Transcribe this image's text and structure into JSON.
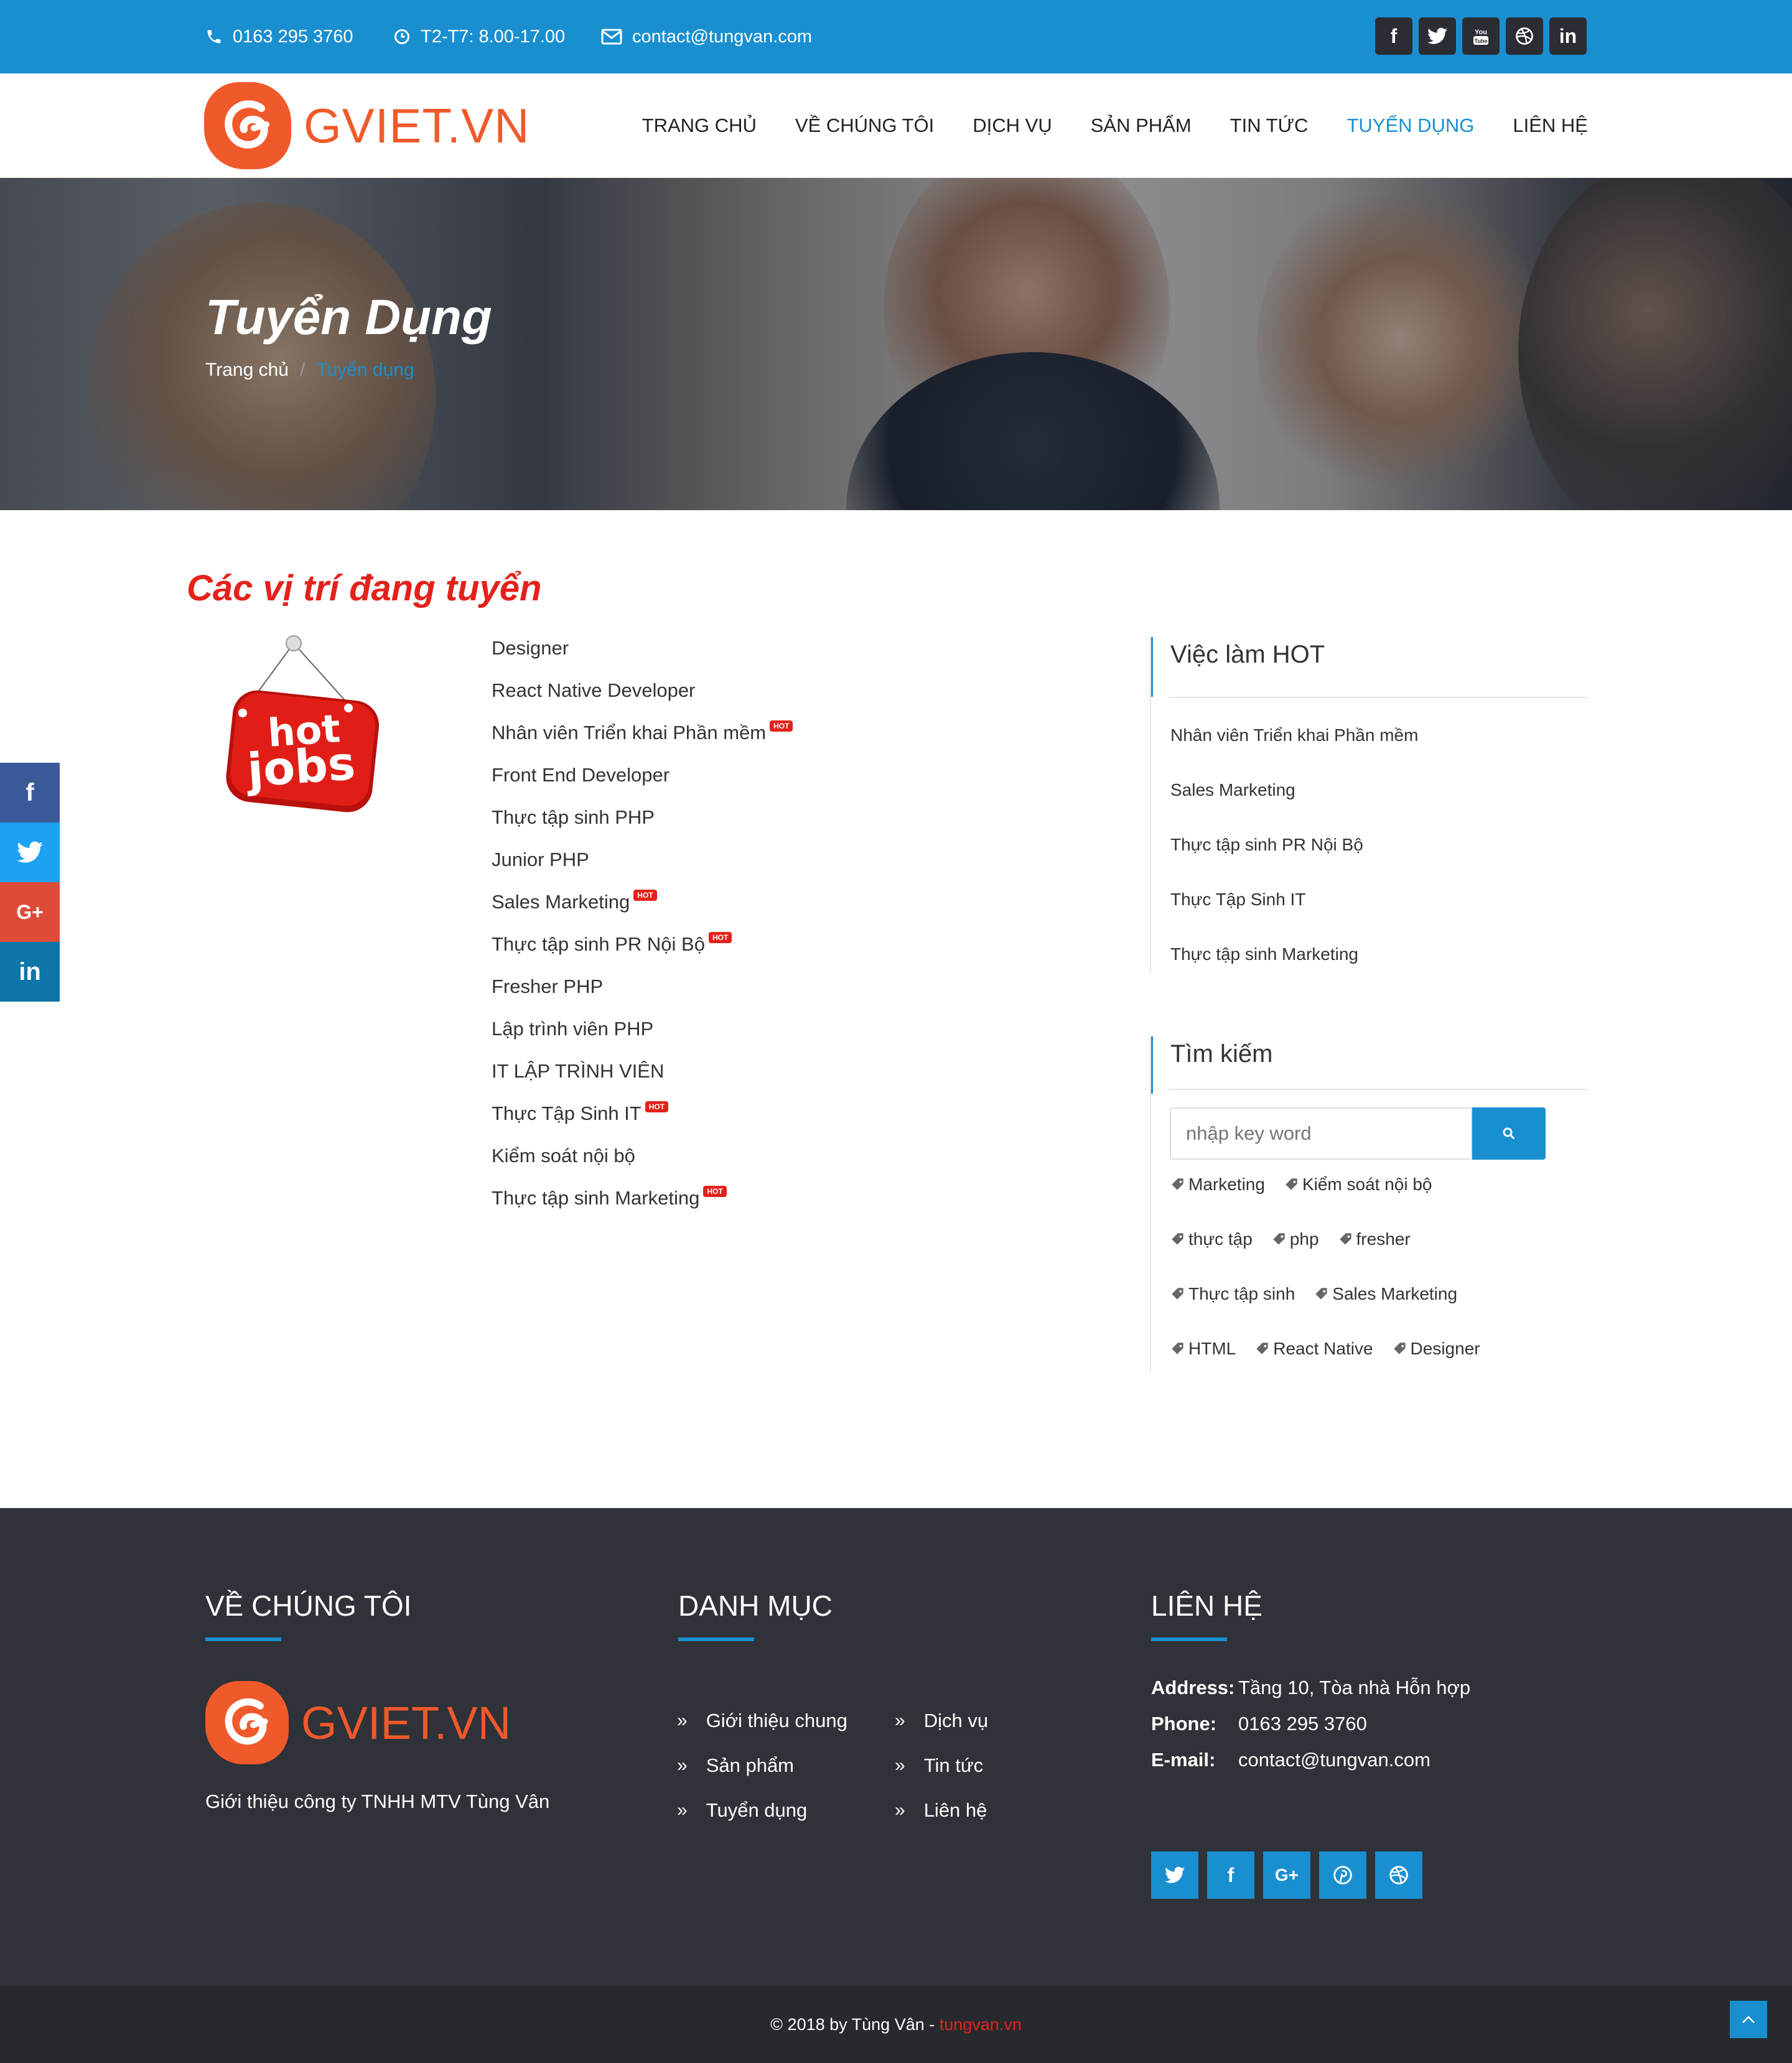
{
  "topbar": {
    "phone": "0163 295 3760",
    "hours": "T2-T7: 8.00-17.00",
    "email": "contact@tungvan.com",
    "social": [
      "facebook",
      "twitter",
      "youtube",
      "dribbble",
      "linkedin"
    ]
  },
  "header": {
    "logo_text": "GVIET.VN",
    "nav": [
      {
        "label": "TRANG CHỦ"
      },
      {
        "label": "VỀ CHÚNG TÔI"
      },
      {
        "label": "DỊCH VỤ"
      },
      {
        "label": "SẢN PHẨM"
      },
      {
        "label": "TIN TỨC"
      },
      {
        "label": "TUYỂN DỤNG",
        "active": true
      },
      {
        "label": "LIÊN HỆ"
      }
    ]
  },
  "banner": {
    "title": "Tuyển Dụng",
    "breadcrumb_home": "Trang chủ",
    "breadcrumb_sep": "/",
    "breadcrumb_current": "Tuyển dụng"
  },
  "main": {
    "section_title": "Các vị trí đang tuyển",
    "image_alt": "hot jobs",
    "hot_label": "HOT",
    "jobs": [
      {
        "title": "Designer",
        "hot": false
      },
      {
        "title": "React Native Developer",
        "hot": false
      },
      {
        "title": "Nhân viên Triển khai Phần mềm",
        "hot": true
      },
      {
        "title": "Front End Developer",
        "hot": false
      },
      {
        "title": "Thực tập sinh PHP",
        "hot": false
      },
      {
        "title": "Junior PHP",
        "hot": false
      },
      {
        "title": "Sales Marketing",
        "hot": true
      },
      {
        "title": "Thực tập sinh PR Nội Bộ",
        "hot": true
      },
      {
        "title": "Fresher PHP",
        "hot": false
      },
      {
        "title": "Lập trình viên PHP",
        "hot": false
      },
      {
        "title": "IT LẬP TRÌNH VIÊN",
        "hot": false
      },
      {
        "title": "Thực Tập Sinh IT",
        "hot": true
      },
      {
        "title": "Kiểm soát nội bộ",
        "hot": false
      },
      {
        "title": "Thực tập sinh Marketing",
        "hot": true
      }
    ]
  },
  "sidebar": {
    "hot_title": "Việc làm HOT",
    "hot_items": [
      "Nhân viên Triển khai Phần mềm",
      "Sales Marketing",
      "Thực tập sinh PR Nội Bộ",
      "Thực Tập Sinh IT",
      "Thực tập sinh Marketing"
    ],
    "search_title": "Tìm kiếm",
    "search_placeholder": "nhập key word",
    "tag_rows": [
      [
        "Marketing",
        "Kiểm soát nội bộ"
      ],
      [
        "thực tập",
        "php",
        "fresher"
      ],
      [
        "Thực tập sinh",
        "Sales Marketing"
      ],
      [
        "HTML",
        "React Native",
        "Designer"
      ]
    ]
  },
  "sticky_social": [
    "facebook",
    "twitter",
    "google-plus",
    "linkedin"
  ],
  "footer": {
    "about_title": "VỀ CHÚNG TÔI",
    "about_logo": "GVIET.VN",
    "about_text": "Giới thiệu công ty TNHH MTV Tùng Vân",
    "menu_title": "DANH MỤC",
    "menu_col1": [
      "Giới thiệu chung",
      "Sản phẩm",
      "Tuyển dụng"
    ],
    "menu_col2": [
      "Dịch vụ",
      "Tin tức",
      "Liên hệ"
    ],
    "contact_title": "LIÊN HỆ",
    "address_label": "Address:",
    "address": "Tầng 10, Tòa nhà Hỗn hợp",
    "phone_label": "Phone:",
    "phone": "0163 295 3760",
    "email_label": "E-mail:",
    "email": "contact@tungvan.com",
    "social": [
      "twitter",
      "facebook",
      "google-plus",
      "pinterest",
      "dribbble"
    ]
  },
  "copyright": {
    "text": "© 2018 by Tùng Vân - ",
    "link": "tungvan.vn"
  },
  "colors": {
    "primary": "#1a8fd0",
    "accent_red": "#e3221b",
    "logo_orange": "#f0592a",
    "footer_bg": "#2f3238"
  }
}
